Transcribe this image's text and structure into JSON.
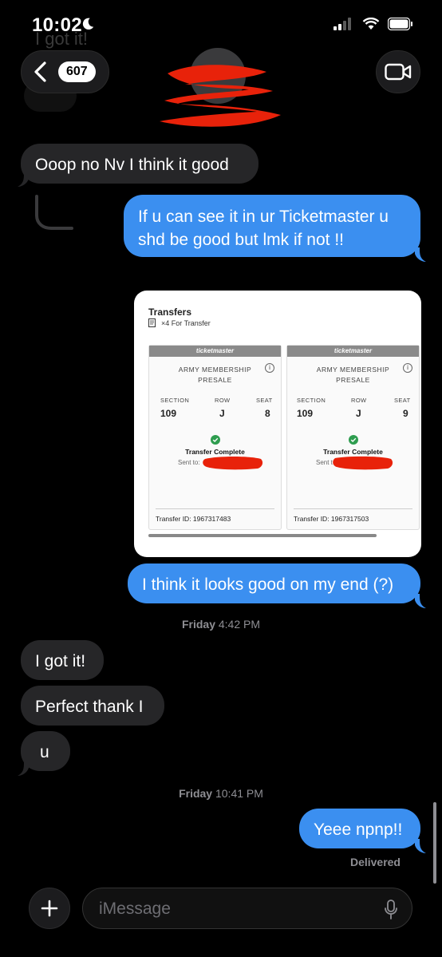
{
  "status_bar": {
    "time": "10:02"
  },
  "header": {
    "unread_count": "607"
  },
  "ghost": {
    "text": "I got it!"
  },
  "messages": [
    {
      "text": "Ooop no Nv I think it good"
    },
    {
      "text": "If u can see it in ur Ticketmaster u shd be good but lmk if not !!"
    },
    {
      "text": "I think it looks good on my end (?)"
    },
    {
      "text": "I got it!"
    },
    {
      "text": "Perfect thank I"
    },
    {
      "text": "u"
    },
    {
      "text": "Yeee npnp!!"
    }
  ],
  "timestamps": [
    {
      "day": "Friday",
      "time": "4:42 PM"
    },
    {
      "day": "Friday",
      "time": "10:41 PM"
    }
  ],
  "delivered": "Delivered",
  "transfer_card": {
    "title": "Transfers",
    "subtitle": "×4 For Transfer",
    "tickets": [
      {
        "brand": "ticketmaster",
        "event_line1": "ARMY MEMBERSHIP",
        "event_line2": "PRESALE",
        "section_label": "SECTION",
        "row_label": "ROW",
        "seat_label": "SEAT",
        "section": "109",
        "row": "J",
        "seat": "8",
        "status": "Transfer Complete",
        "sent_label": "Sent to:",
        "transfer_id": "Transfer ID: 1967317483"
      },
      {
        "brand": "ticketmaster",
        "event_line1": "ARMY MEMBERSHIP",
        "event_line2": "PRESALE",
        "section_label": "SECTION",
        "row_label": "ROW",
        "seat_label": "SEAT",
        "section": "109",
        "row": "J",
        "seat": "9",
        "status": "Transfer Complete",
        "sent_label": "Sent t",
        "transfer_id": "Transfer ID: 1967317503"
      }
    ]
  },
  "input": {
    "placeholder": "iMessage"
  },
  "colors": {
    "outgoing": "#3b8ff0",
    "incoming": "#262628",
    "redaction": "#e8220a",
    "check": "#2e9d4f"
  }
}
